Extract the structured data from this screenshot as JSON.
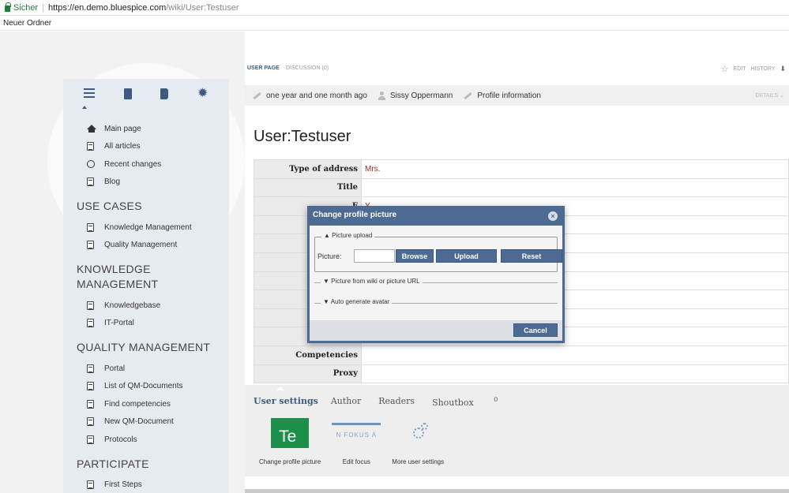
{
  "browser": {
    "secure_label": "Sicher",
    "url_host": "https://en.demo.bluespice.com",
    "url_path": "/wiki/User:Testuser",
    "bookmark": "Neuer Ordner"
  },
  "sidebar": {
    "icons": [
      "menu-icon",
      "clipboard-icon",
      "book-icon",
      "gear-icon"
    ],
    "main_items": [
      {
        "label": "Main page",
        "icon": "home-icon"
      },
      {
        "label": "All articles",
        "icon": "document-icon"
      },
      {
        "label": "Recent changes",
        "icon": "clock-icon"
      },
      {
        "label": "Blog",
        "icon": "document-icon"
      }
    ],
    "sections": [
      {
        "title": "USE CASES",
        "items": [
          "Knowledge Management",
          "Quality Management"
        ]
      },
      {
        "title": "KNOWLEDGE MANAGEMENT",
        "items": [
          "Knowledgebase",
          "IT-Portal"
        ]
      },
      {
        "title": "QUALITY MANAGEMENT",
        "items": [
          "Portal",
          "List of QM-Documents",
          "Find competencies",
          "New QM-Document",
          "Protocols"
        ]
      },
      {
        "title": "PARTICIPATE",
        "items": [
          "First Steps"
        ]
      }
    ]
  },
  "content": {
    "tab_user": "USER PAGE",
    "tab_discussion": "DISCUSSION (0)",
    "tool_edit": "EDIT",
    "tool_history": "HISTORY",
    "info_time": "one year and one month ago",
    "info_author": "Sissy Oppermann",
    "info_profile": "Profile information",
    "details": "DETAILS",
    "page_title": "User:Testuser",
    "table": [
      {
        "label": "Type of address",
        "value": "Mrs."
      },
      {
        "label": "Title",
        "value": ""
      },
      {
        "label": "F",
        "value": "Y"
      },
      {
        "label": "",
        "value": ""
      },
      {
        "label": "",
        "value": ""
      },
      {
        "label": "",
        "value": ""
      },
      {
        "label": "",
        "value": ""
      },
      {
        "label": "",
        "value": ""
      },
      {
        "label": "",
        "value": ""
      },
      {
        "label": "",
        "value": ""
      },
      {
        "label": "Competencies",
        "value": ""
      },
      {
        "label": "Proxy",
        "value": ""
      }
    ],
    "bottom_tabs": {
      "user_settings": "User settings",
      "author": "Author",
      "readers": "Readers",
      "shoutbox": "Shoutbox",
      "shoutbox_count": "0"
    },
    "tiles": {
      "change_picture_label": "Change profile picture",
      "avatar_text": "Te",
      "edit_focus_label": "Edit focus",
      "focus_text": "N FOKUS A",
      "more_settings_label": "More user settings"
    }
  },
  "modal": {
    "title": "Change profile picture",
    "upload_legend": "Picture upload",
    "picture_label": "Picture:",
    "picture_value": "",
    "browse": "Browse",
    "upload": "Upload",
    "reset": "Reset",
    "from_wiki": "Picture from wiki or picture URL",
    "auto_avatar": "Auto generate avatar",
    "cancel": "Cancel"
  }
}
